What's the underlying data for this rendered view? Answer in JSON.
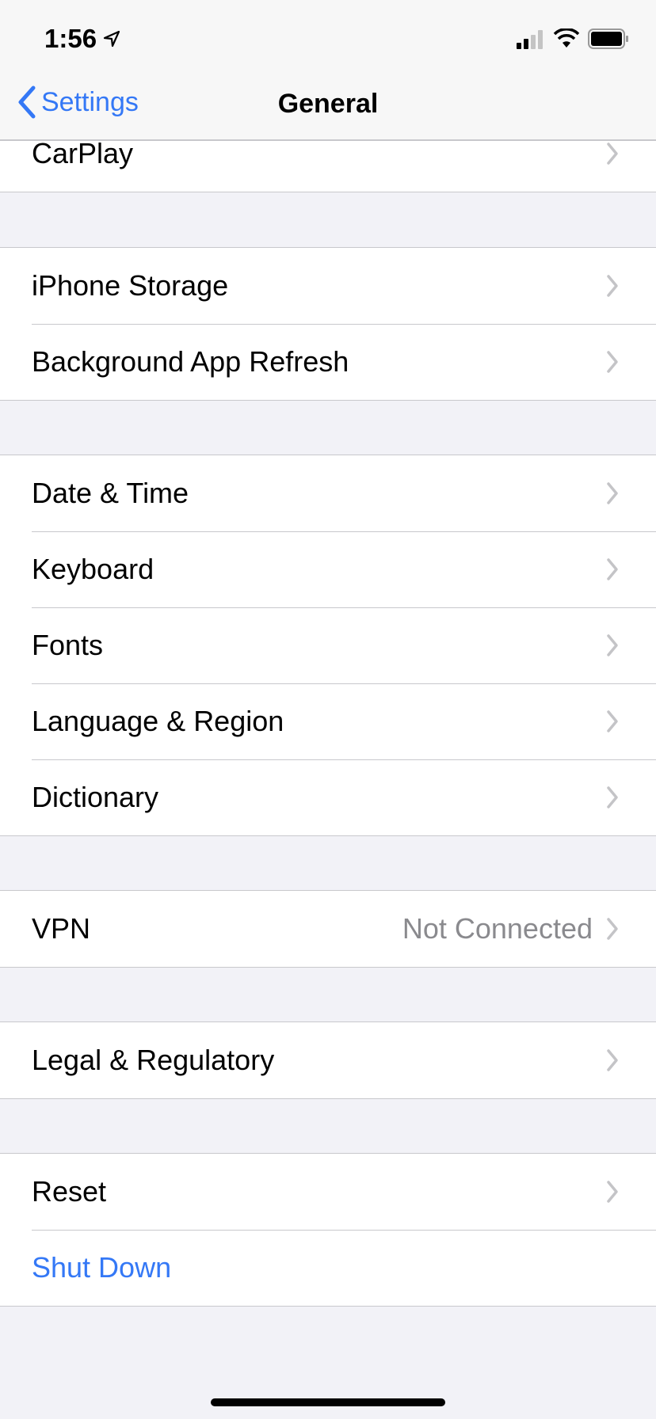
{
  "status_bar": {
    "time": "1:56",
    "icons": [
      "location-arrow-icon",
      "signal-icon",
      "wifi-icon",
      "battery-icon"
    ]
  },
  "nav": {
    "back_label": "Settings",
    "title": "General"
  },
  "groups": [
    {
      "rows": [
        {
          "label": "CarPlay",
          "chevron": true
        }
      ]
    },
    {
      "rows": [
        {
          "label": "iPhone Storage",
          "chevron": true
        },
        {
          "label": "Background App Refresh",
          "chevron": true
        }
      ]
    },
    {
      "rows": [
        {
          "label": "Date & Time",
          "chevron": true
        },
        {
          "label": "Keyboard",
          "chevron": true
        },
        {
          "label": "Fonts",
          "chevron": true
        },
        {
          "label": "Language & Region",
          "chevron": true
        },
        {
          "label": "Dictionary",
          "chevron": true
        }
      ]
    },
    {
      "rows": [
        {
          "label": "VPN",
          "detail": "Not Connected",
          "chevron": true
        }
      ]
    },
    {
      "rows": [
        {
          "label": "Legal & Regulatory",
          "chevron": true
        }
      ]
    },
    {
      "rows": [
        {
          "label": "Reset",
          "chevron": true
        },
        {
          "label": "Shut Down",
          "chevron": false,
          "accent": true
        }
      ]
    }
  ],
  "colors": {
    "accent": "#3478f6",
    "background": "#f2f2f7",
    "separator": "#c8c8cc",
    "detail": "#8a8a8e",
    "chevron": "#c4c4c7"
  }
}
